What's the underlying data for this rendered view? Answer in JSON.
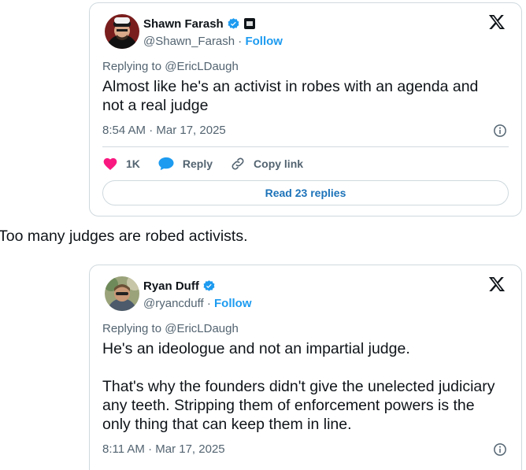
{
  "tweets": [
    {
      "display_name": "Shawn Farash",
      "handle": "@Shawn_Farash",
      "separator": " · ",
      "follow_label": "Follow",
      "replying_to": "Replying to @EricLDaugh",
      "text": "Almost like he's an activist in robes with an agenda and\nnot a real judge",
      "timestamp": "8:54 AM · Mar 17, 2025",
      "like_count": "1K",
      "reply_label": "Reply",
      "copy_link_label": "Copy link",
      "read_replies_label": "Read 23 replies"
    },
    {
      "display_name": "Ryan Duff",
      "handle": "@ryancduff",
      "separator": " · ",
      "follow_label": "Follow",
      "replying_to": "Replying to @EricLDaugh",
      "text": "He's an ideologue and not an impartial judge.\n\nThat's why the founders didn't give the unelected judiciary\nany teeth. Stripping them of enforcement powers is the\nonly thing that can keep them in line.",
      "timestamp": "8:11 AM · Mar 17, 2025"
    }
  ],
  "between_text": "Too many judges are robed activists.",
  "colors": {
    "accent": "#1d9bf0",
    "heart": "#f91880",
    "text": "#0f1419",
    "muted": "#536471",
    "border": "#cfd9de"
  },
  "icons": {
    "verified": "verified-badge-icon",
    "affiliation": "affiliation-badge-icon",
    "brand": "x-logo-icon",
    "info": "info-icon",
    "like": "heart-icon",
    "reply": "speech-bubble-icon",
    "copy": "link-icon"
  }
}
